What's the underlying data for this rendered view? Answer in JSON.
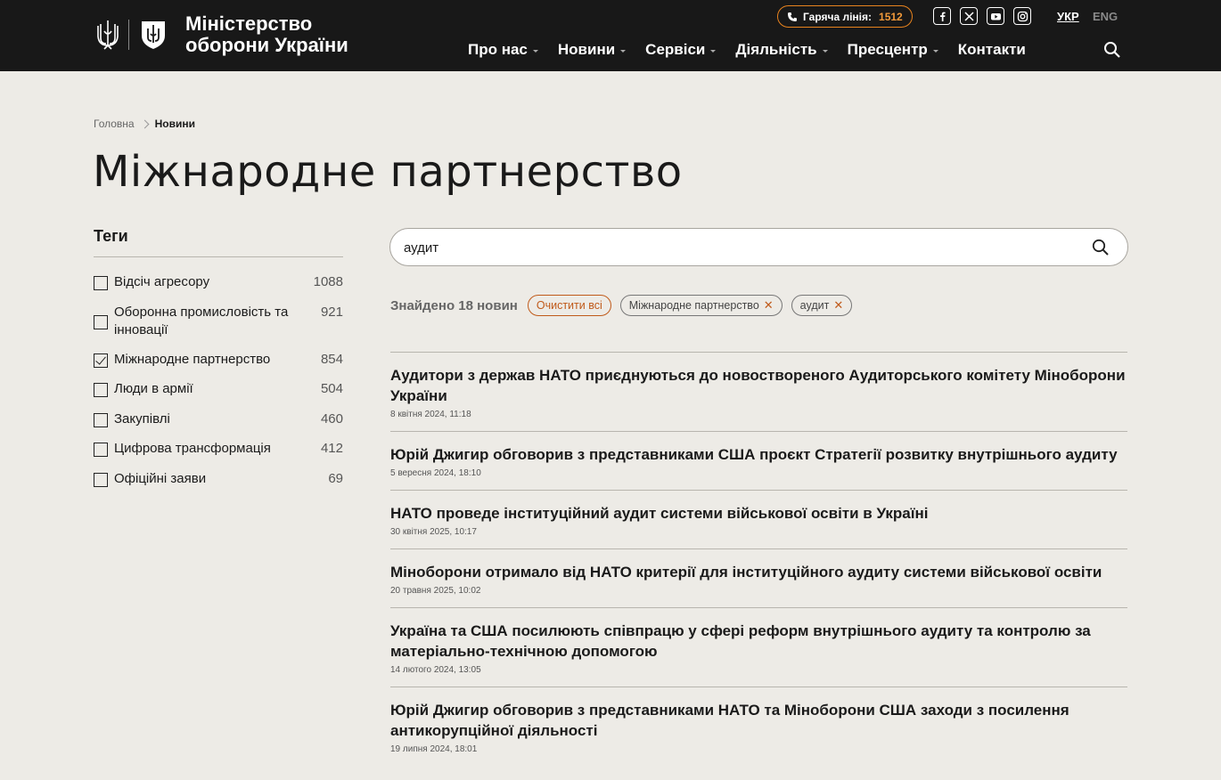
{
  "header": {
    "brand_line1": "Міністерство",
    "brand_line2": "оборони України",
    "hotline_label": "Гаряча лінія:",
    "hotline_number": "1512",
    "social_icons": [
      "facebook-icon",
      "x-icon",
      "youtube-icon",
      "instagram-icon"
    ],
    "lang_active": "УКР",
    "lang_other": "ENG",
    "nav": [
      "Про нас",
      "Новини",
      "Сервіси",
      "Діяльність",
      "Пресцентр",
      "Контакти"
    ],
    "accent_color": "#e8831e"
  },
  "breadcrumb": {
    "home": "Головна",
    "current": "Новини"
  },
  "page_title": "Міжнародне партнерство",
  "sidebar": {
    "title": "Теги",
    "tags": [
      {
        "label": "Відсіч агресору",
        "count": "1088",
        "checked": false
      },
      {
        "label": "Оборонна промисловість та інновації",
        "count": "921",
        "checked": false
      },
      {
        "label": "Міжнародне партнерство",
        "count": "854",
        "checked": true
      },
      {
        "label": "Люди в армії",
        "count": "504",
        "checked": false
      },
      {
        "label": "Закупівлі",
        "count": "460",
        "checked": false
      },
      {
        "label": "Цифрова трансформація",
        "count": "412",
        "checked": false
      },
      {
        "label": "Офіційні заяви",
        "count": "69",
        "checked": false
      }
    ]
  },
  "search": {
    "value": "аудит"
  },
  "filters": {
    "found_text": "Знайдено 18 новин",
    "clear_all": "Очистити всі",
    "chips": [
      "Міжнародне партнерство",
      "аудит"
    ]
  },
  "results": [
    {
      "title": "Аудитори з держав НАТО приєднуються до новоствореного Аудиторського комітету Міноборони України",
      "date": "8 квітня 2024, 11:18"
    },
    {
      "title": "Юрій Джигир обговорив з представниками США проєкт Стратегії розвитку внутрішнього аудиту",
      "date": "5 вересня 2024, 18:10"
    },
    {
      "title": "НАТО проведе інституційний аудит системи військової освіти в Україні",
      "date": "30 квітня 2025, 10:17"
    },
    {
      "title": "Міноборони отримало від НАТО критерії для інституційного аудиту системи військової освіти",
      "date": "20 травня 2025, 10:02"
    },
    {
      "title": "Україна та США посилюють співпрацю у сфері реформ внутрішнього аудиту та контролю за матеріально-технічною допомогою",
      "date": "14 лютого 2024, 13:05"
    },
    {
      "title": "Юрій Джигир обговорив з представниками НАТО та Міноборони США заходи з посилення антикорупційної діяльності",
      "date": "19 липня 2024, 18:01"
    }
  ]
}
